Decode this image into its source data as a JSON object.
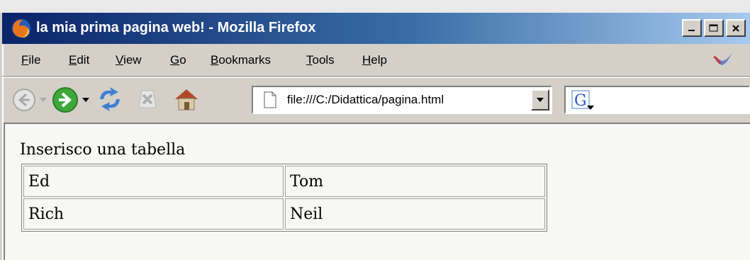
{
  "window": {
    "title": "la mia prima pagina web! - Mozilla Firefox"
  },
  "menu": {
    "items": [
      {
        "first": "F",
        "rest": "ile"
      },
      {
        "first": "E",
        "rest": "dit"
      },
      {
        "first": "V",
        "rest": "iew"
      },
      {
        "first": "G",
        "rest": "o"
      },
      {
        "first": "B",
        "rest": "ookmarks"
      },
      {
        "first": "T",
        "rest": "ools"
      },
      {
        "first": "H",
        "rest": "elp"
      }
    ]
  },
  "address": {
    "url": "file:///C:/Didattica/pagina.html"
  },
  "page": {
    "intro": "Inserisco una tabella",
    "table": [
      [
        "Ed",
        "Tom"
      ],
      [
        "Rich",
        "Neil"
      ]
    ]
  },
  "colors": {
    "titlebar_start": "#0a246a",
    "titlebar_end": "#a6caf0",
    "chrome": "#d4d0c8"
  },
  "icons": [
    "firefox-icon",
    "minimize-icon",
    "maximize-icon",
    "close-icon",
    "throbber-icon",
    "back-icon",
    "forward-icon",
    "reload-icon",
    "stop-icon",
    "home-icon",
    "page-icon",
    "dropdown-arrow-icon",
    "google-icon"
  ]
}
